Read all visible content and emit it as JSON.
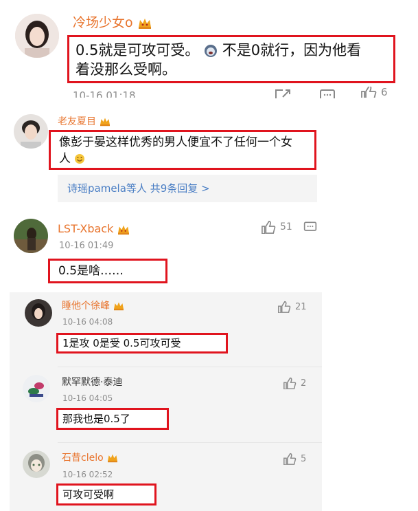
{
  "c1": {
    "username": "冷场少女o",
    "text_line1_a": "0.5就是可攻可受。",
    "text_line1_b": "不是0就行，因为他看",
    "text_line2": "着没那么受啊。",
    "time": "10-16 01:18",
    "likes": "6",
    "avatar_icon": "avatar-girl"
  },
  "c2": {
    "username": "老友夏目",
    "text_line1": "像彭于晏这样优秀的男人便宜不了任何一个女",
    "text_line2": "人",
    "replies_link": "诗瑶pamela等人",
    "replies_count": "共9条回复",
    "replies_arrow": ">"
  },
  "c3": {
    "username": "LST-Xback",
    "time": "10-16 01:49",
    "likes": "51",
    "text": "0.5是啥……"
  },
  "replies": [
    {
      "username": "睡他个徐峰",
      "time": "10-16 04:08",
      "likes": "21",
      "text": "1是攻  0是受  0.5可攻可受",
      "vip": true
    },
    {
      "username": "默罕默德·泰迪",
      "time": "10-16 04:05",
      "likes": "2",
      "text": "那我也是0.5了",
      "vip": false
    },
    {
      "username": "石昔clelo",
      "time": "10-16 02:52",
      "likes": "5",
      "text": "可攻可受啊",
      "vip": true
    }
  ],
  "colors": {
    "accent_orange": "#e8742d",
    "highlight_red": "#e0141e",
    "link_blue": "#4a7ec4",
    "meta_gray": "#8e8e8e"
  }
}
